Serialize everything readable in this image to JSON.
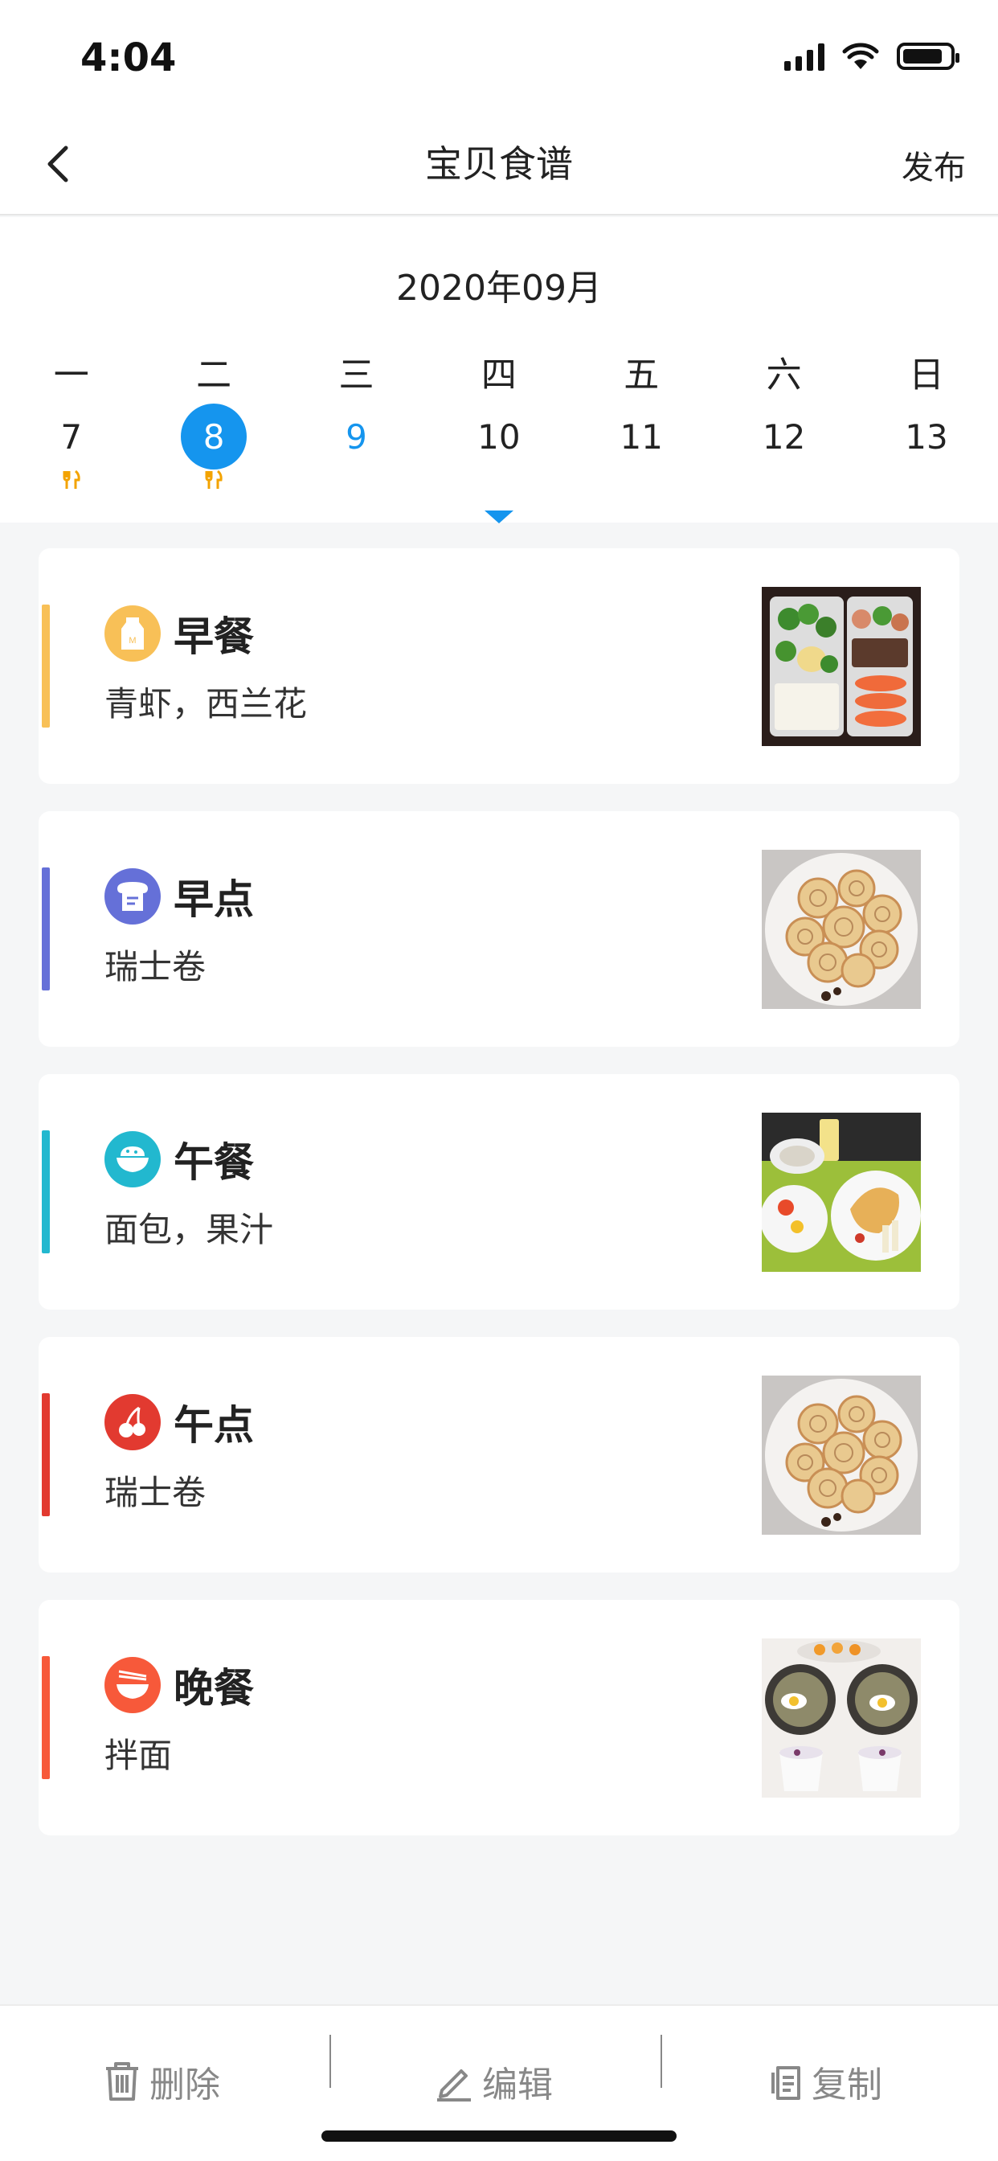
{
  "status_bar": {
    "time": "4:04"
  },
  "nav": {
    "title": "宝贝食谱",
    "publish_label": "发布"
  },
  "calendar": {
    "month_label": "2020年09月",
    "weekdays": [
      "一",
      "二",
      "三",
      "四",
      "五",
      "六",
      "日"
    ],
    "dates": [
      {
        "label": "7",
        "state": "normal",
        "has_meal": true
      },
      {
        "label": "8",
        "state": "selected",
        "has_meal": true
      },
      {
        "label": "9",
        "state": "today",
        "has_meal": false
      },
      {
        "label": "10",
        "state": "normal",
        "has_meal": false
      },
      {
        "label": "11",
        "state": "normal",
        "has_meal": false
      },
      {
        "label": "12",
        "state": "normal",
        "has_meal": false
      },
      {
        "label": "13",
        "state": "normal",
        "has_meal": false
      }
    ]
  },
  "meals": [
    {
      "name": "早餐",
      "desc": "青虾，西兰花",
      "color": "#f8c057",
      "icon": "milk-icon",
      "photo": "lunchbox-photo"
    },
    {
      "name": "早点",
      "desc": "瑞士卷",
      "color": "#6570d8",
      "icon": "bread-icon",
      "photo": "swiss-roll-photo"
    },
    {
      "name": "午餐",
      "desc": "面包，果汁",
      "color": "#22b8cf",
      "icon": "rice-bowl-icon",
      "photo": "bread-juice-photo"
    },
    {
      "name": "午点",
      "desc": "瑞士卷",
      "color": "#e23a30",
      "icon": "cherry-icon",
      "photo": "swiss-roll-photo"
    },
    {
      "name": "晚餐",
      "desc": "拌面",
      "color": "#f7593a",
      "icon": "noodle-bowl-icon",
      "photo": "dinner-set-photo"
    }
  ],
  "toolbar": {
    "delete_label": "删除",
    "edit_label": "编辑",
    "copy_label": "复制"
  },
  "colors": {
    "accent": "#1595ee",
    "meal_mark": "#f3a300"
  }
}
